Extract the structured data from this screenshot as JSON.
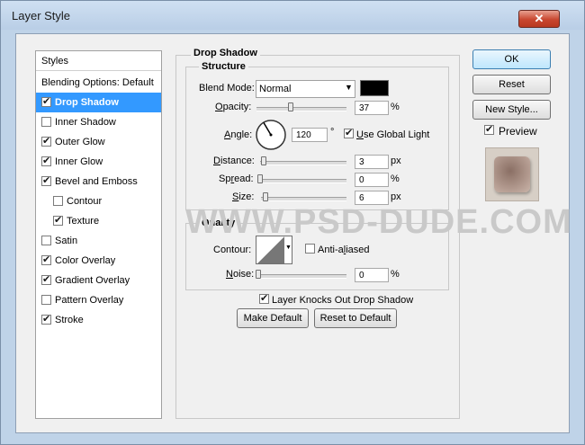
{
  "window": {
    "title": "Layer Style",
    "close_label": "✕"
  },
  "styles_panel": {
    "header": "Styles",
    "items": [
      {
        "label": "Blending Options: Default",
        "checkbox": false,
        "checked": false,
        "selected": false,
        "indent": 0
      },
      {
        "label": "Drop Shadow",
        "checkbox": true,
        "checked": true,
        "selected": true,
        "indent": 0
      },
      {
        "label": "Inner Shadow",
        "checkbox": true,
        "checked": false,
        "selected": false,
        "indent": 0
      },
      {
        "label": "Outer Glow",
        "checkbox": true,
        "checked": true,
        "selected": false,
        "indent": 0
      },
      {
        "label": "Inner Glow",
        "checkbox": true,
        "checked": true,
        "selected": false,
        "indent": 0
      },
      {
        "label": "Bevel and Emboss",
        "checkbox": true,
        "checked": true,
        "selected": false,
        "indent": 0
      },
      {
        "label": "Contour",
        "checkbox": true,
        "checked": false,
        "selected": false,
        "indent": 1
      },
      {
        "label": "Texture",
        "checkbox": true,
        "checked": true,
        "selected": false,
        "indent": 1
      },
      {
        "label": "Satin",
        "checkbox": true,
        "checked": false,
        "selected": false,
        "indent": 0
      },
      {
        "label": "Color Overlay",
        "checkbox": true,
        "checked": true,
        "selected": false,
        "indent": 0
      },
      {
        "label": "Gradient Overlay",
        "checkbox": true,
        "checked": true,
        "selected": false,
        "indent": 0
      },
      {
        "label": "Pattern Overlay",
        "checkbox": true,
        "checked": false,
        "selected": false,
        "indent": 0
      },
      {
        "label": "Stroke",
        "checkbox": true,
        "checked": true,
        "selected": false,
        "indent": 0
      }
    ]
  },
  "drop_shadow": {
    "section_title": "Drop Shadow",
    "structure": {
      "title": "Structure",
      "blend_mode_label": "Blend Mode:",
      "blend_mode_value": "Normal",
      "shadow_color": "#000000",
      "opacity_label": "Opacity:",
      "opacity_value": "37",
      "opacity_unit": "%",
      "opacity_fraction": 0.37,
      "angle_label": "Angle:",
      "angle_value": "120",
      "angle_unit": "°",
      "use_global_light_label": "Use Global Light",
      "use_global_light_checked": true,
      "distance_label": "Distance:",
      "distance_value": "3",
      "distance_unit": "px",
      "distance_fraction": 0.01,
      "spread_label": "Spread:",
      "spread_value": "0",
      "spread_unit": "%",
      "spread_fraction": 0.0,
      "size_label": "Size:",
      "size_value": "6",
      "size_unit": "px",
      "size_fraction": 0.02
    },
    "quality": {
      "title": "Quality",
      "contour_label": "Contour:",
      "anti_aliased_label": "Anti-aliased",
      "anti_aliased_checked": false,
      "noise_label": "Noise:",
      "noise_value": "0",
      "noise_unit": "%",
      "noise_fraction": 0.0
    },
    "knocks_out_label": "Layer Knocks Out Drop Shadow",
    "knocks_out_checked": true,
    "make_default_label": "Make Default",
    "reset_default_label": "Reset to Default"
  },
  "buttons": {
    "ok": "OK",
    "reset": "Reset",
    "new_style": "New Style..."
  },
  "preview": {
    "label": "Preview",
    "checked": true
  },
  "watermark": "WWW.PSD-DUDE.COM",
  "colors": {
    "selection": "#3399ff",
    "dialog_bg": "#f0f0f0",
    "frame": "#bfd3e8",
    "close": "#c8462f"
  }
}
